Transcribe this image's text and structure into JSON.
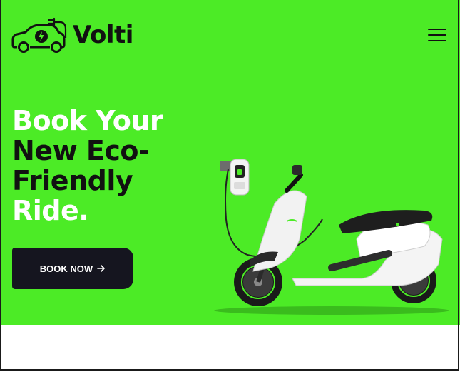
{
  "brand": {
    "name": "Volti",
    "logo_icon": "ev-car-plug-icon"
  },
  "header": {
    "menu_icon": "hamburger-menu-icon"
  },
  "hero": {
    "headline_lines": [
      "Book Your",
      "New Eco-",
      "Friendly",
      "Ride."
    ],
    "cta_label": "BOOK NOW",
    "cta_icon": "arrow-right-icon",
    "image": "electric-scooter-with-charging-station"
  },
  "colors": {
    "hero_bg": "#4ceb26",
    "dark": "#15151f",
    "text_light": "#ffffff"
  }
}
